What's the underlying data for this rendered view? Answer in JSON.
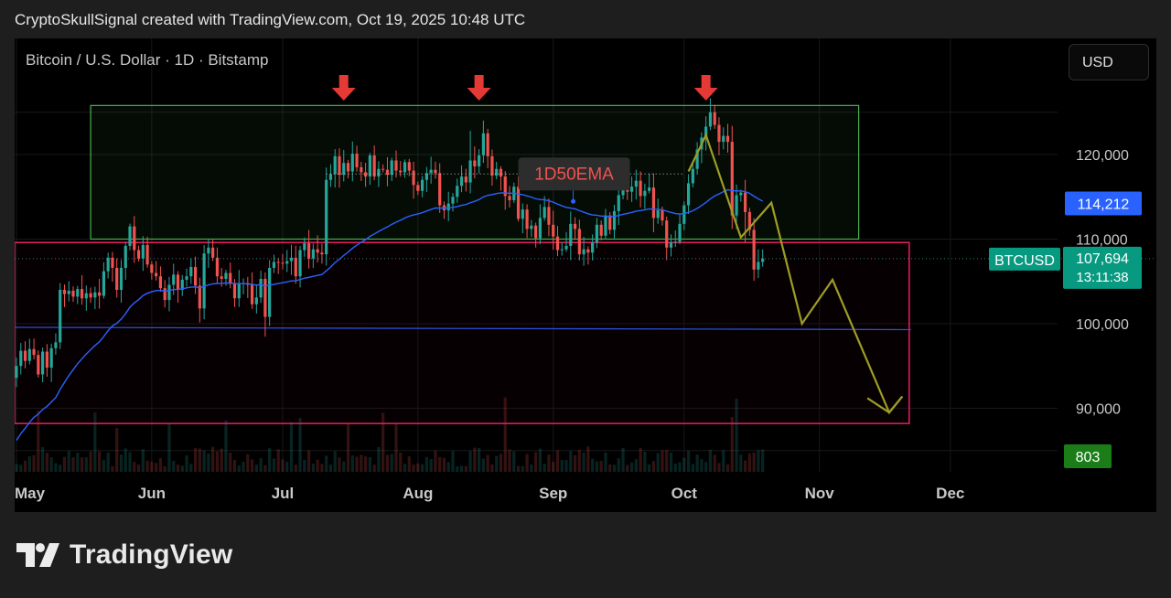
{
  "caption": "CryptoSkullSignal created with TradingView.com, Oct 19, 2025 10:48 UTC",
  "chart_title": "Bitcoin / U.S. Dollar · 1D · Bitstamp",
  "currency_button": "USD",
  "brand": "TradingView",
  "colors": {
    "up": "#26a69a",
    "down": "#ef5350",
    "ema": "#2962ff",
    "range_box": "#4caf50",
    "channel_box": "#e91e63",
    "projection": "#9e9d24",
    "arrow": "#e53935"
  },
  "chart_data": {
    "type": "candlestick",
    "symbol": "BTCUSD",
    "ylim": [
      85000,
      126000
    ],
    "y_ticks": [
      90000,
      100000,
      110000,
      120000
    ],
    "y_tick_labels": [
      "90,000",
      "100,000",
      "110,000",
      "120,000"
    ],
    "x_tick_labels": [
      "May",
      "Jun",
      "Jul",
      "Aug",
      "Sep",
      "Oct",
      "Nov",
      "Dec"
    ],
    "x_tick_days": [
      0,
      31,
      61,
      92,
      123,
      153,
      184,
      214
    ],
    "ema_label": "1D50EMA",
    "ema_value": 114212,
    "ema_value_label": "114,212",
    "last_price": 107694,
    "last_price_label": "107,694",
    "countdown": "13:11:38",
    "price_tag": "BTCUSD",
    "volume_label": "803",
    "closes": [
      95000,
      96800,
      95600,
      97000,
      96300,
      94000,
      96700,
      94800,
      97100,
      97800,
      104000,
      103500,
      103900,
      103200,
      104100,
      103000,
      103600,
      103100,
      103700,
      103300,
      106200,
      107800,
      106600,
      104000,
      106600,
      109200,
      111500,
      108700,
      107700,
      109300,
      107000,
      106000,
      105600,
      104200,
      102800,
      104600,
      105800,
      104000,
      105200,
      105600,
      106700,
      104500,
      101800,
      108300,
      109000,
      107800,
      105600,
      105300,
      106000,
      104700,
      103000,
      104700,
      104800,
      104600,
      102300,
      103100,
      105300,
      100800,
      106600,
      107300,
      107200,
      107100,
      107400,
      107800,
      105600,
      108700,
      109500,
      107700,
      108800,
      108400,
      108200,
      117000,
      117700,
      119800,
      117600,
      119000,
      118000,
      120100,
      118500,
      117900,
      117400,
      119900,
      117400,
      118300,
      118200,
      117600,
      119300,
      118100,
      117900,
      119100,
      118100,
      116400,
      115700,
      117000,
      117800,
      118200,
      117800,
      114000,
      113400,
      114200,
      115000,
      116300,
      117400,
      116700,
      119300,
      118600,
      119900,
      122500,
      119800,
      117500,
      118300,
      117400,
      115100,
      114600,
      116200,
      112400,
      113500,
      111200,
      111600,
      110100,
      112500,
      113800,
      111700,
      110300,
      108700,
      108800,
      109200,
      111800,
      111200,
      108200,
      108800,
      108400,
      109600,
      111700,
      110400,
      112800,
      111100,
      113300,
      115200,
      116500,
      115600,
      116200,
      116900,
      115100,
      115700,
      116100,
      112500,
      113400,
      112200,
      109000,
      109600,
      109700,
      111800,
      114000,
      116600,
      118300,
      120600,
      122000,
      123300,
      125000,
      123500,
      121500,
      122200,
      121500,
      112800,
      115200,
      115500,
      113200,
      111100,
      106400,
      107300,
      107700
    ]
  }
}
